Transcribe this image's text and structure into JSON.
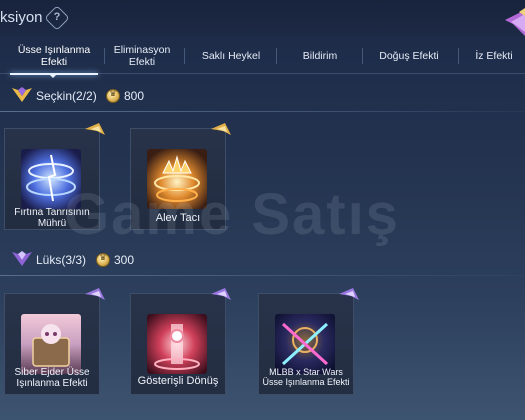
{
  "header": {
    "title": "ksiyon",
    "help_icon": "question-diamond-icon"
  },
  "tabs": [
    {
      "label": "Üsse Işınlanma Efekti",
      "active": true
    },
    {
      "label": "Eliminasyon Efekti",
      "active": false
    },
    {
      "label": "Saklı Heykel",
      "active": false
    },
    {
      "label": "Bildirim",
      "active": false
    },
    {
      "label": "Doğuş Efekti",
      "active": false
    },
    {
      "label": "İz Efekti",
      "active": false
    }
  ],
  "sections": [
    {
      "title": "Seçkin(2/2)",
      "cost": "800",
      "rank_icon": "purple-gold-rank-icon",
      "items": [
        {
          "label": "Fırtına Tanrısının Mührü",
          "art": "storm-seal-art"
        },
        {
          "label": "Alev Tacı",
          "art": "flame-crown-art"
        }
      ]
    },
    {
      "title": "Lüks(3/3)",
      "cost": "300",
      "rank_icon": "purple-rank-icon",
      "items": [
        {
          "label": "Siber Ejder Üsse Işınlanma Efekti",
          "art": "cyber-dragon-art"
        },
        {
          "label": "Gösterişli Dönüş",
          "art": "showy-return-art"
        },
        {
          "label": "MLBB x Star Wars Üsse Işınlanma Efekti",
          "art": "star-wars-art"
        }
      ]
    }
  ],
  "watermark": "Game Satış",
  "colors": {
    "accent": "#e9c46a",
    "purple": "#7a4fd8",
    "background": "#22324f"
  }
}
